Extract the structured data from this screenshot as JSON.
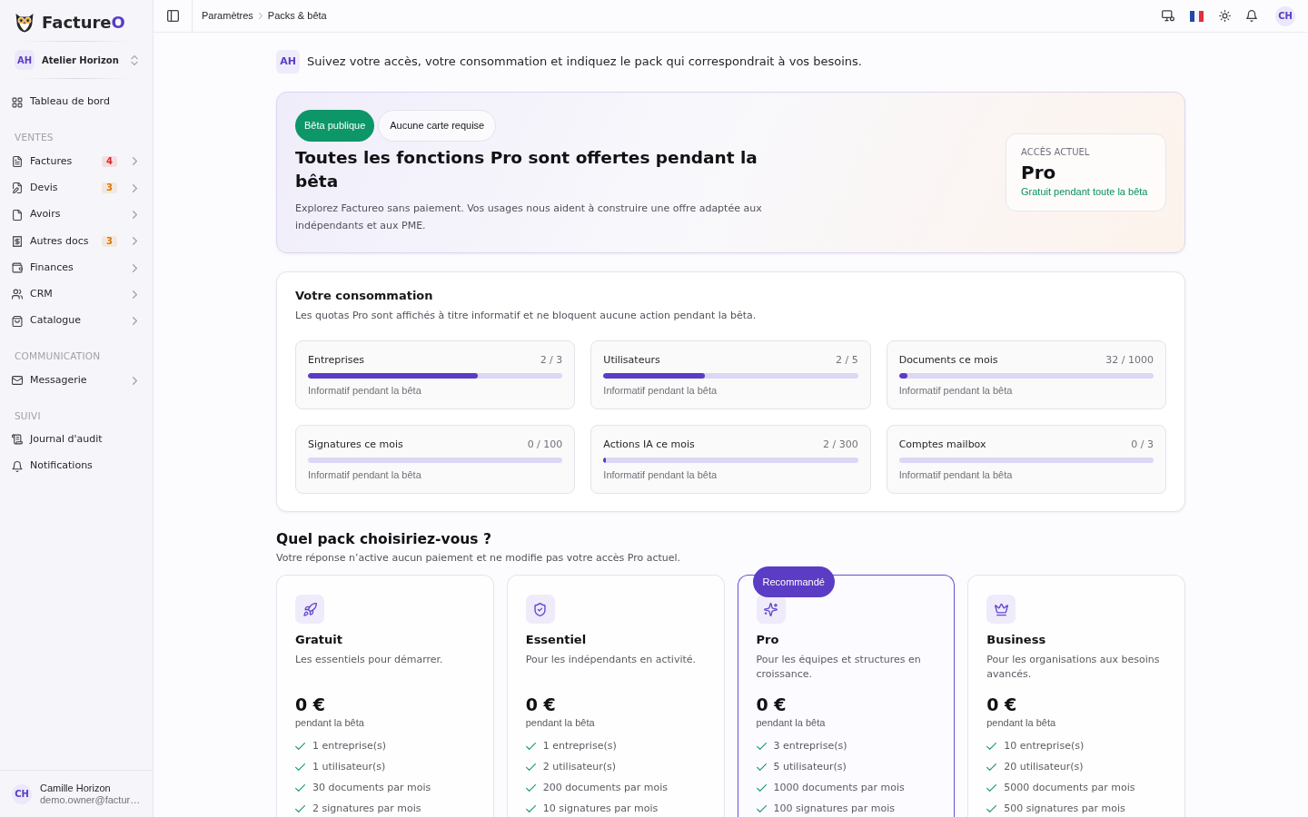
{
  "sidebar": {
    "logo": {
      "text": "Facture",
      "accent": "O"
    },
    "workspace": {
      "initials": "AH",
      "name": "Atelier Horizon"
    },
    "items": [
      {
        "label": "Tableau de bord",
        "submenu": false
      }
    ],
    "sections": [
      {
        "title": "VENTES",
        "items": [
          {
            "label": "Factures",
            "badge": {
              "text": "4",
              "color": "#dc2626"
            },
            "submenu": true
          },
          {
            "label": "Devis",
            "badge": {
              "text": "3",
              "color": "#d97706"
            },
            "submenu": true
          },
          {
            "label": "Avoirs",
            "submenu": true
          },
          {
            "label": "Autres docs",
            "badge": {
              "text": "3",
              "color": "#d97706"
            },
            "submenu": true
          },
          {
            "label": "Finances",
            "submenu": true
          },
          {
            "label": "CRM",
            "submenu": true
          },
          {
            "label": "Catalogue",
            "submenu": true
          }
        ]
      },
      {
        "title": "COMMUNICATION",
        "items": [
          {
            "label": "Messagerie",
            "submenu": true
          }
        ]
      },
      {
        "title": "SUIVI",
        "items": [
          {
            "label": "Journal d'audit",
            "submenu": false
          },
          {
            "label": "Notifications",
            "submenu": false
          }
        ]
      }
    ],
    "user": {
      "initials": "CH",
      "name": "Camille Horizon",
      "email": "demo.owner@factur…"
    }
  },
  "topbar": {
    "breadcrumb": [
      "Paramètres",
      "Packs & bêta"
    ],
    "avatar": "CH"
  },
  "intro": {
    "initials": "AH",
    "text": "Suivez votre accès, votre consommation et indiquez le pack qui correspondrait à vos besoins."
  },
  "hero": {
    "tags": [
      {
        "label": "Bêta publique",
        "kind": "solid"
      },
      {
        "label": "Aucune carte requise",
        "kind": "outline"
      }
    ],
    "title": "Toutes les fonctions Pro sont offertes pendant la bêta",
    "description": "Explorez Factureo sans paiement. Vos usages nous aident à construire une offre adaptée aux indépendants et aux PME.",
    "access": {
      "label": "ACCÈS ACTUEL",
      "plan": "Pro",
      "note": "Gratuit pendant toute la bêta"
    }
  },
  "usage": {
    "title": "Votre consommation",
    "subtitle": "Les quotas Pro sont affichés à titre informatif et ne bloquent aucune action pendant la bêta.",
    "meters": [
      {
        "label": "Entreprises",
        "reading": "2 / 3",
        "level": 0.667,
        "note": "Informatif pendant la bêta"
      },
      {
        "label": "Utilisateurs",
        "reading": "2 / 5",
        "level": 0.4,
        "note": "Informatif pendant la bêta"
      },
      {
        "label": "Documents ce mois",
        "reading": "32 / 1000",
        "level": 0.032,
        "note": "Informatif pendant la bêta"
      },
      {
        "label": "Signatures ce mois",
        "reading": "0 / 100",
        "level": 0,
        "note": "Informatif pendant la bêta"
      },
      {
        "label": "Actions IA ce mois",
        "reading": "2 / 300",
        "level": 0.007,
        "note": "Informatif pendant la bêta"
      },
      {
        "label": "Comptes mailbox",
        "reading": "0 / 3",
        "level": 0,
        "note": "Informatif pendant la bêta"
      }
    ]
  },
  "packs": {
    "title": "Quel pack choisiriez-vous ?",
    "subtitle": "Votre réponse n’active aucun paiement et ne modifie pas votre accès Pro actuel.",
    "plans": [
      {
        "name": "Gratuit",
        "description": "Les essentiels pour démarrer.",
        "price": "0 €",
        "price_note": "pendant la bêta",
        "recommended": false,
        "features": [
          "1 entreprise(s)",
          "1 utilisateur(s)",
          "30 documents par mois",
          "2 signatures par mois"
        ]
      },
      {
        "name": "Essentiel",
        "description": "Pour les indépendants en activité.",
        "price": "0 €",
        "price_note": "pendant la bêta",
        "recommended": false,
        "features": [
          "1 entreprise(s)",
          "2 utilisateur(s)",
          "200 documents par mois",
          "10 signatures par mois"
        ]
      },
      {
        "name": "Pro",
        "description": "Pour les équipes et structures en croissance.",
        "price": "0 €",
        "price_note": "pendant la bêta",
        "recommended": true,
        "badge": "Recommandé",
        "features": [
          "3 entreprise(s)",
          "5 utilisateur(s)",
          "1000 documents par mois",
          "100 signatures par mois"
        ]
      },
      {
        "name": "Business",
        "description": "Pour les organisations aux besoins avancés.",
        "price": "0 €",
        "price_note": "pendant la bêta",
        "recommended": false,
        "features": [
          "10 entreprise(s)",
          "20 utilisateur(s)",
          "5000 documents par mois",
          "500 signatures par mois"
        ]
      }
    ]
  }
}
